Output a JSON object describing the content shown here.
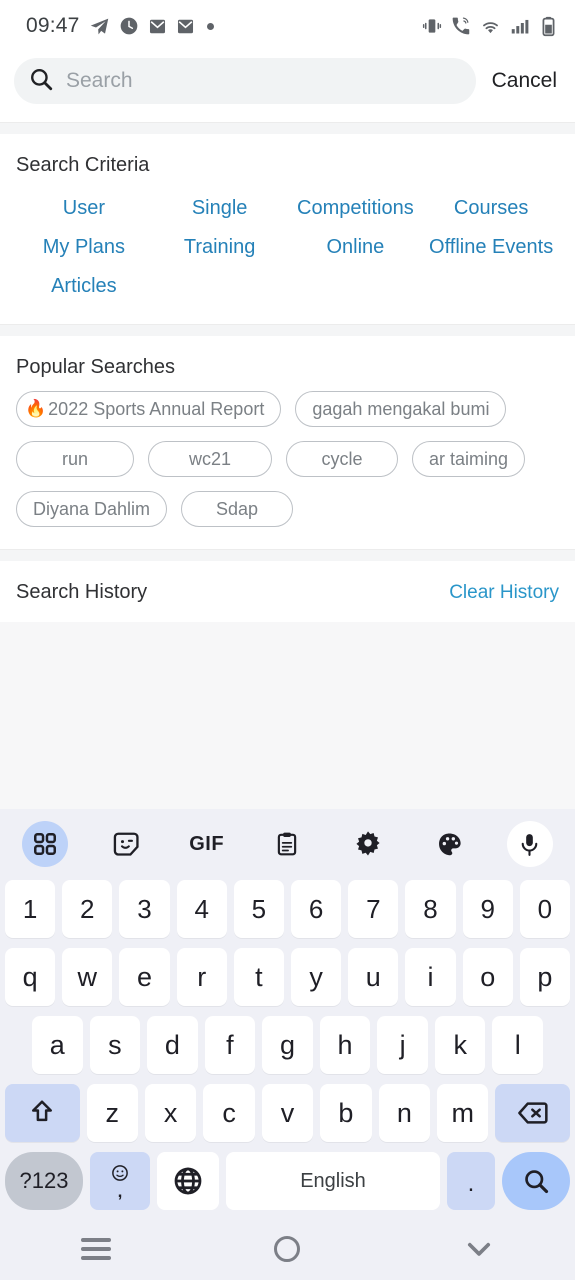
{
  "statusbar": {
    "time": "09:47",
    "left_icons": [
      "telegram-icon",
      "clock-icon",
      "mail-icon",
      "mail-icon",
      "dot-indicator"
    ],
    "right_icons": [
      "vibrate-icon",
      "wifi-calling-icon",
      "wifi-icon",
      "signal-icon",
      "battery-icon"
    ]
  },
  "search": {
    "placeholder": "Search",
    "value": "",
    "cancel_label": "Cancel",
    "icon": "search-icon"
  },
  "criteria": {
    "title": "Search Criteria",
    "items": [
      {
        "label": "User"
      },
      {
        "label": "Single"
      },
      {
        "label": "Competitions"
      },
      {
        "label": "Courses"
      },
      {
        "label": "My Plans"
      },
      {
        "label": "Training"
      },
      {
        "label": "Online"
      },
      {
        "label": "Offline Events"
      },
      {
        "label": "Articles"
      }
    ]
  },
  "popular": {
    "title": "Popular Searches",
    "chips": [
      {
        "label": "2022 Sports Annual Report",
        "hot": true,
        "hot_icon": "flame-icon"
      },
      {
        "label": "gagah mengakal bumi",
        "hot": false
      },
      {
        "label": "run",
        "hot": false
      },
      {
        "label": "wc21",
        "hot": false
      },
      {
        "label": "cycle",
        "hot": false
      },
      {
        "label": "ar taiming",
        "hot": false
      },
      {
        "label": "Diyana Dahlim",
        "hot": false
      },
      {
        "label": "Sdap",
        "hot": false
      }
    ]
  },
  "history": {
    "title": "Search History",
    "clear_label": "Clear History",
    "items": []
  },
  "keyboard": {
    "toolbar": [
      {
        "name": "grid-icon",
        "active": true
      },
      {
        "name": "sticker-icon",
        "active": false
      },
      {
        "name": "gif-icon",
        "label": "GIF",
        "active": false
      },
      {
        "name": "clipboard-icon",
        "active": false
      },
      {
        "name": "gear-icon",
        "active": false
      },
      {
        "name": "palette-icon",
        "active": false
      },
      {
        "name": "microphone-icon",
        "active": false
      }
    ],
    "row_numbers": [
      "1",
      "2",
      "3",
      "4",
      "5",
      "6",
      "7",
      "8",
      "9",
      "0"
    ],
    "row_qwerty": [
      "q",
      "w",
      "e",
      "r",
      "t",
      "y",
      "u",
      "i",
      "o",
      "p"
    ],
    "row_asdf": [
      "a",
      "s",
      "d",
      "f",
      "g",
      "h",
      "j",
      "k",
      "l"
    ],
    "row_zxcv": [
      "z",
      "x",
      "c",
      "v",
      "b",
      "n",
      "m"
    ],
    "shift_icon": "shift-icon",
    "backspace_icon": "backspace-icon",
    "symbols_label": "?123",
    "emoji_icon": "emoji-icon",
    "comma_label": ",",
    "globe_icon": "globe-icon",
    "space_label": "English",
    "period_label": ".",
    "enter_icon": "search-icon"
  },
  "navbar": {
    "recents": "recents-icon",
    "home": "home-icon",
    "back": "hide-keyboard-icon"
  },
  "colors": {
    "link_blue": "#2581b8",
    "action_blue": "#2a96c9",
    "chip_border": "#bdc1c6",
    "flame_orange": "#f4511e",
    "key_accent": "#a8c7fa"
  }
}
